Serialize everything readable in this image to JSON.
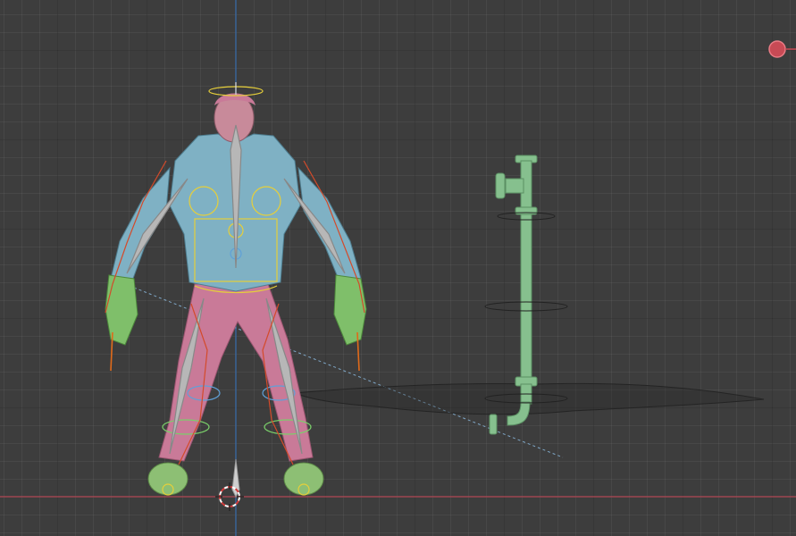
{
  "viewport": {
    "background": "#3d3d3d",
    "x_axis_color": "#b24a55",
    "z_axis_color": "#3a6fae"
  },
  "scene": {
    "character_body_color": "#7fb1c4",
    "character_pants_color": "#c97a98",
    "character_skin_color": "#c88a9a",
    "character_hands_color": "#7fbf6a",
    "armature_outline_color": "#e6cf3a",
    "armature_accent_color": "#d44a2a",
    "pipe_color": "#86c08e",
    "camera_marker_color": "#c84a55",
    "icons": [
      "3d-cursor-icon",
      "light-icon",
      "camera-marker-icon"
    ]
  }
}
